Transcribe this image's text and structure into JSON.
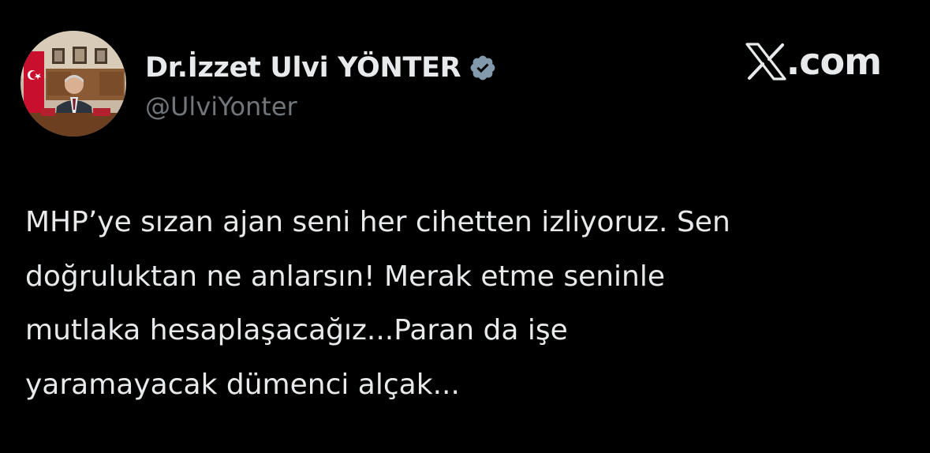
{
  "author": {
    "display_name": "Dr.İzzet Ulvi YÖNTER",
    "handle": "@UlviYonter",
    "verified": true,
    "avatar_icon": "profile-photo"
  },
  "brand": {
    "logo_icon": "x-logo-icon",
    "domain": ".com"
  },
  "tweet": {
    "lines": [
      "MHP’ye sızan ajan seni her cihetten izliyoruz. Sen",
      "doğruluktan ne anlarsın! Merak etme seninle",
      "mutlaka hesaplaşacağız...Paran da işe",
      "yaramayacak dümenci alçak..."
    ]
  },
  "colors": {
    "background": "#000000",
    "text_primary": "#e7e9ea",
    "text_secondary": "#71767b",
    "verified_badge": "#829aab"
  }
}
